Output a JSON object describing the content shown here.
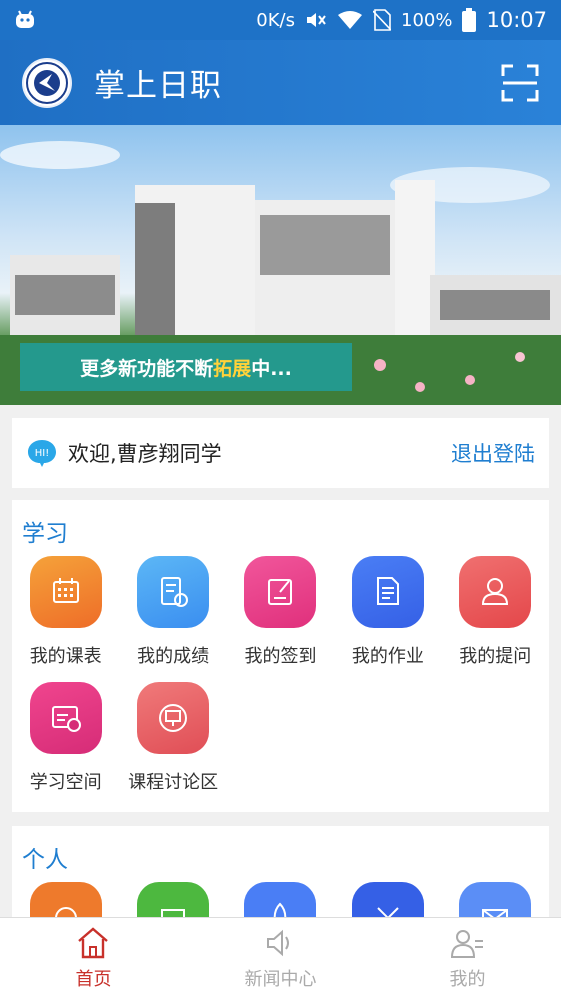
{
  "status_bar": {
    "speed": "0K/s",
    "battery": "100%",
    "time": "10:07",
    "icons": [
      "android-icon",
      "mute-icon",
      "wifi-icon",
      "no-sim-icon",
      "battery-icon"
    ]
  },
  "app_bar": {
    "title": "掌上日职",
    "scan_icon": "scan-icon"
  },
  "banner": {
    "caption_prefix": "更多新功能不断",
    "caption_highlight": "拓展",
    "caption_suffix": "中..."
  },
  "welcome": {
    "greeting": "欢迎,曹彦翔同学",
    "logout": "退出登陆"
  },
  "study": {
    "title": "学习",
    "items": [
      {
        "label": "我的课表",
        "icon": "calendar-icon",
        "color_from": "#f5a23a",
        "color_to": "#ee6d28"
      },
      {
        "label": "我的成绩",
        "icon": "report-icon",
        "color_from": "#5cb7f6",
        "color_to": "#3a8ef0"
      },
      {
        "label": "我的签到",
        "icon": "sign-icon",
        "color_from": "#f1569b",
        "color_to": "#e0307c"
      },
      {
        "label": "我的作业",
        "icon": "homework-icon",
        "color_from": "#4a7ef5",
        "color_to": "#3560e6"
      },
      {
        "label": "我的提问",
        "icon": "question-icon",
        "color_from": "#f07070",
        "color_to": "#e4474a"
      },
      {
        "label": "学习空间",
        "icon": "schedule-icon",
        "color_from": "#f0458e",
        "color_to": "#d62c77"
      },
      {
        "label": "课程讨论区",
        "icon": "discussion-icon",
        "color_from": "#f07a7a",
        "color_to": "#e04e56"
      }
    ]
  },
  "personal": {
    "title": "个人",
    "items": [
      {
        "icon": "clock-icon",
        "color": "#ee7a2c"
      },
      {
        "icon": "wallet-icon",
        "color": "#4db83f"
      },
      {
        "icon": "rocket-icon",
        "color": "#4a7ef5"
      },
      {
        "icon": "tools-icon",
        "color": "#3560e6"
      },
      {
        "icon": "mail-icon",
        "color": "#5b8ef6"
      }
    ]
  },
  "tab_bar": {
    "tabs": [
      {
        "label": "首页",
        "icon": "home-icon",
        "active": true
      },
      {
        "label": "新闻中心",
        "icon": "speaker-icon",
        "active": false
      },
      {
        "label": "我的",
        "icon": "profile-icon",
        "active": false
      }
    ]
  },
  "colors": {
    "primary": "#1f72c7",
    "accent_text": "#1f7ed0",
    "active_tab": "#c8312b"
  }
}
